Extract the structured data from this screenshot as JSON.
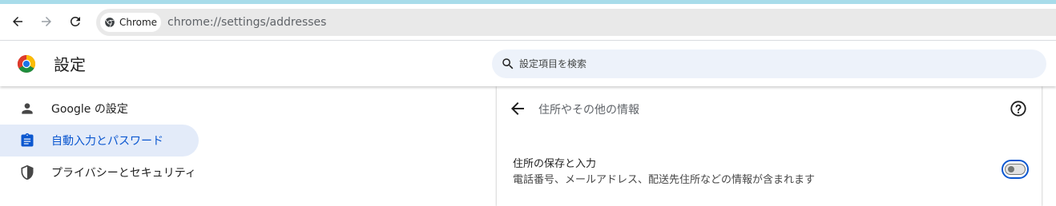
{
  "browser": {
    "chip_label": "Chrome",
    "url": "chrome://settings/addresses"
  },
  "header": {
    "title": "設定",
    "search_placeholder": "設定項目を検索"
  },
  "sidebar": {
    "items": [
      {
        "label": "Google の設定",
        "icon": "person-icon",
        "active": false
      },
      {
        "label": "自動入力とパスワード",
        "icon": "clipboard-icon",
        "active": true
      },
      {
        "label": "プライバシーとセキュリティ",
        "icon": "shield-icon",
        "active": false
      }
    ]
  },
  "page": {
    "title": "住所やその他の情報",
    "setting": {
      "title": "住所の保存と入力",
      "description": "電話番号、メールアドレス、配送先住所などの情報が含まれます",
      "enabled": false
    }
  },
  "colors": {
    "accent": "#0b57d0",
    "active_bg": "#e3ebf9",
    "search_bg": "#edf2fa"
  }
}
